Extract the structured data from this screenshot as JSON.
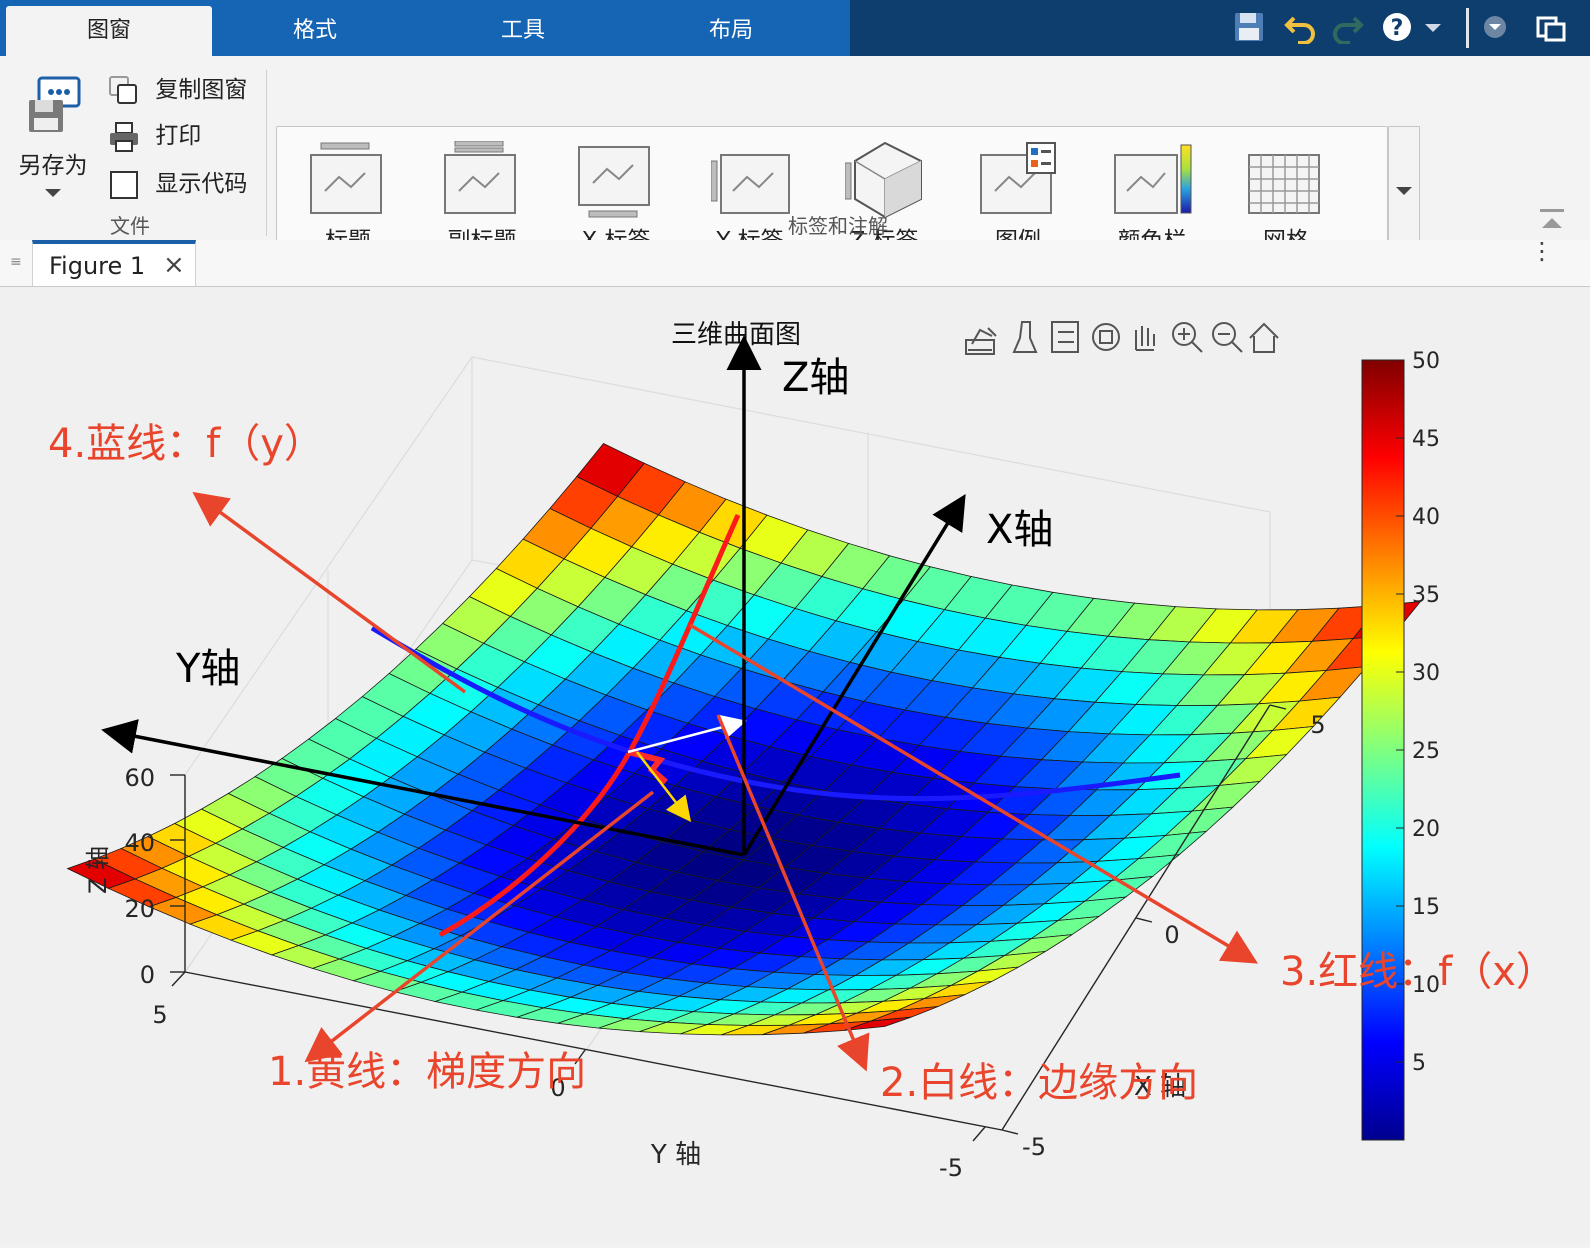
{
  "tabs": [
    "图窗",
    "格式",
    "工具",
    "布局"
  ],
  "active_tab": "图窗",
  "quick_access": [
    "save-icon",
    "undo-icon",
    "redo-icon",
    "help-icon",
    "dropdown-icon",
    "collapse-icon",
    "undock-icon"
  ],
  "ribbon": {
    "file_group": {
      "label": "文件",
      "save_as": "另存为",
      "copy_figure": "复制图窗",
      "print": "打印",
      "show_code": "显示代码",
      "show_code_checked": false
    },
    "labels_group": {
      "label": "标签和注解",
      "items": [
        "标题",
        "副标题",
        "X 标签",
        "Y 标签",
        "Z 标签",
        "图例",
        "颜色栏",
        "网格"
      ]
    }
  },
  "figure_tab": {
    "title": "Figure 1",
    "close": "×"
  },
  "axes_toolbar": [
    "export-icon",
    "brush-icon",
    "data-tips-icon",
    "rotate-icon",
    "pan-icon",
    "zoom-in-icon",
    "zoom-out-icon",
    "home-icon"
  ],
  "chart_data": {
    "type": "surface",
    "title": "三维曲面图",
    "xlabel": "X 轴",
    "ylabel": "Y 轴",
    "zlabel": "Z 轴",
    "xlim": [
      -5,
      5
    ],
    "ylim": [
      -5,
      5
    ],
    "zlim": [
      0,
      60
    ],
    "x_ticks": [
      "-5",
      "0",
      "5"
    ],
    "y_ticks": [
      "-5",
      "0",
      "5"
    ],
    "z_ticks": [
      "0",
      "20",
      "40",
      "60"
    ],
    "surface_function": "z = x^2 + y^2",
    "grid": true,
    "colormap": "jet",
    "colorbar": {
      "range": [
        0,
        50
      ],
      "ticks": [
        "5",
        "10",
        "15",
        "20",
        "25",
        "30",
        "35",
        "40",
        "45",
        "50"
      ]
    }
  },
  "annotations": {
    "axis_z": "Z轴",
    "axis_x": "X轴",
    "axis_y": "Y轴",
    "note1": "1.黄线：梯度方向",
    "note2": "2.白线：边缘方向",
    "note3": "3.红线：f（x）",
    "note4": "4.蓝线：f（y）"
  },
  "colors": {
    "toolbar_bg": "#0d3e6e",
    "tab_strip": "#1565b4",
    "annotation_red": "#e8452c",
    "curve_red": "#ff1a1a",
    "curve_blue": "#1a1aff",
    "gradient_yellow": "#ffd700"
  }
}
